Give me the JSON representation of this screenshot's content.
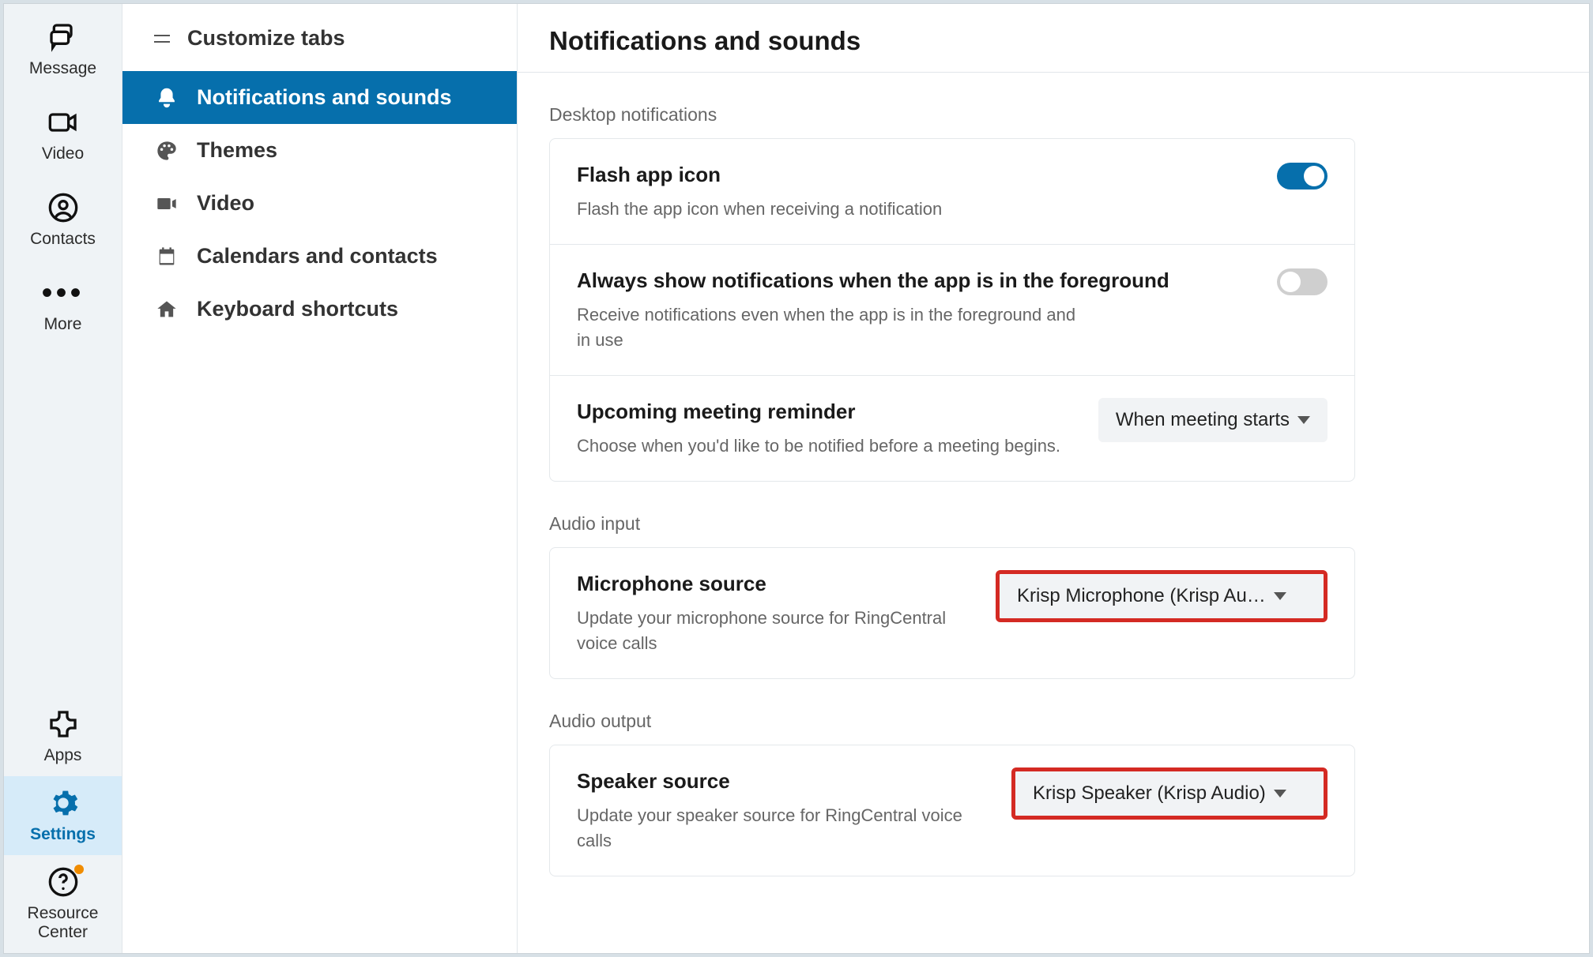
{
  "rail": {
    "message": "Message",
    "video": "Video",
    "contacts": "Contacts",
    "more": "More",
    "apps": "Apps",
    "settings": "Settings",
    "resource_center": "Resource\nCenter"
  },
  "sidebar": {
    "customize": "Customize tabs",
    "items": {
      "notifications": "Notifications and sounds",
      "themes": "Themes",
      "video": "Video",
      "calendars": "Calendars and contacts",
      "keyboard": "Keyboard shortcuts"
    }
  },
  "header": {
    "title": "Notifications and sounds"
  },
  "sections": {
    "desktop": {
      "title": "Desktop notifications",
      "flash": {
        "title": "Flash app icon",
        "desc": "Flash the app icon when receiving a notification",
        "on": true
      },
      "foreground": {
        "title": "Always show notifications when the app is in the foreground",
        "desc": "Receive notifications even when the app is in the foreground and in use",
        "on": false
      },
      "upcoming": {
        "title": "Upcoming meeting reminder",
        "desc": "Choose when you'd like to be notified before a meeting begins.",
        "value": "When meeting starts"
      }
    },
    "audio_in": {
      "title": "Audio input",
      "mic": {
        "title": "Microphone source",
        "desc": "Update your microphone source for RingCentral voice calls",
        "value": "Krisp Microphone (Krisp Au…"
      }
    },
    "audio_out": {
      "title": "Audio output",
      "speaker": {
        "title": "Speaker source",
        "desc": "Update your speaker source for RingCentral voice calls",
        "value": "Krisp Speaker (Krisp Audio)"
      }
    }
  }
}
